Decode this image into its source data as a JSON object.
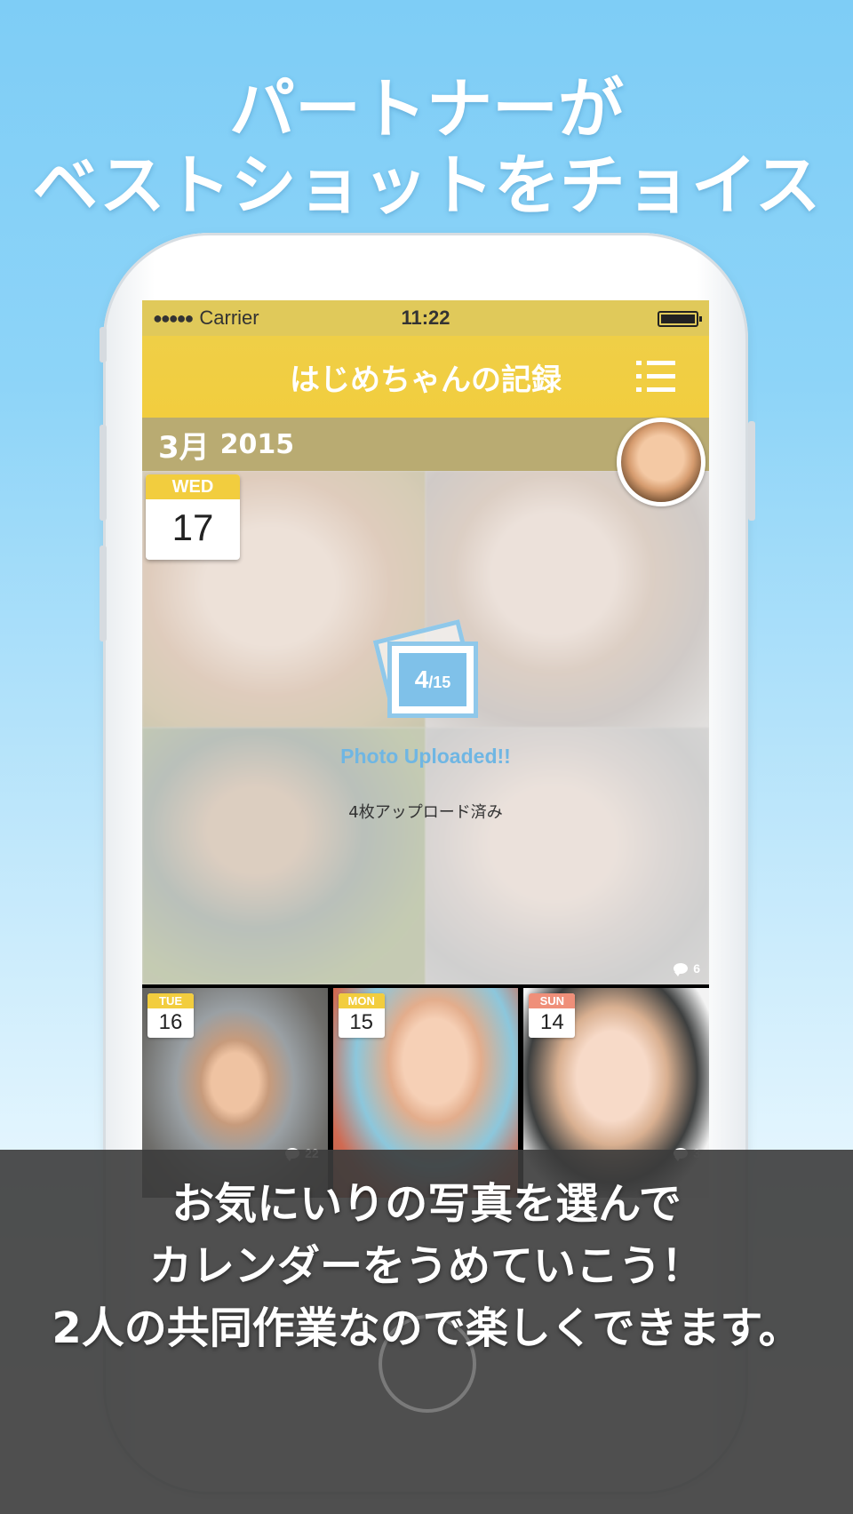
{
  "headline": {
    "line1": "パートナーが",
    "line2": "ベストショットをチョイス"
  },
  "status_bar": {
    "signal": "●●●●●",
    "carrier": "Carrier",
    "time": "11:22"
  },
  "nav": {
    "title": "はじめちゃんの記録",
    "menu_icon": "list-menu-icon"
  },
  "month_header": {
    "month": "3月",
    "year": "2015"
  },
  "main_entry": {
    "weekday": "WED",
    "day": "17",
    "upload_count": "4",
    "upload_total": "/15",
    "upload_status": "Photo Uploaded!!",
    "upload_note": "4枚アップロード済み",
    "comment_count": "6"
  },
  "thumbnails": [
    {
      "weekday": "TUE",
      "day": "16",
      "comment_count": "22",
      "badge_color": "#f2cd3e"
    },
    {
      "weekday": "MON",
      "day": "15",
      "comment_count": "",
      "badge_color": "#f2cd3e"
    },
    {
      "weekday": "SUN",
      "day": "14",
      "comment_count": "3",
      "badge_color": "#ef8f79"
    }
  ],
  "caption": {
    "line1": "お気にいりの写真を選んで",
    "line2": "カレンダーをうめていこう！",
    "line3": "2人の共同作業なので楽しくできます。"
  },
  "colors": {
    "accent": "#f2cd3e",
    "month_bar": "#b9ab72",
    "upload_blue": "#7fc1e9",
    "sunday": "#ef8f79"
  }
}
